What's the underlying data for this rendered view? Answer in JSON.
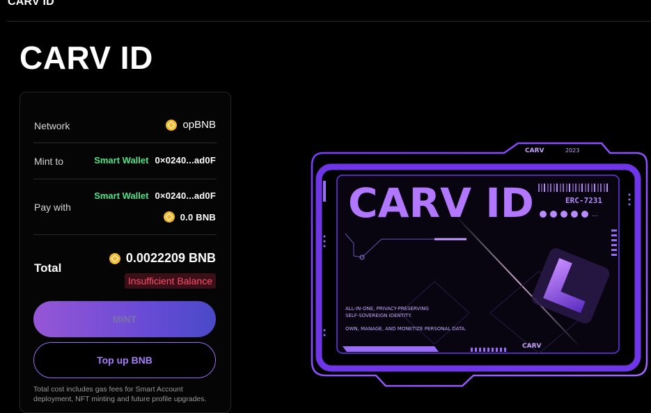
{
  "topbar": {
    "title": "CARV ID"
  },
  "page": {
    "title": "CARV ID"
  },
  "panel": {
    "network": {
      "label": "Network",
      "value": "opBNB"
    },
    "mint_to": {
      "label": "Mint to",
      "wallet": "Smart Wallet",
      "address": "0×0240...ad0F"
    },
    "pay_with": {
      "label": "Pay with",
      "wallet": "Smart Wallet",
      "address": "0×0240...ad0F",
      "balance": "0.0 BNB"
    },
    "total": {
      "label": "Total",
      "value": "0.0022209 BNB",
      "warning": "Insufficient Balance"
    },
    "mint_label": "MINT",
    "topup_label": "Top up BNB",
    "footnote": "Total cost includes gas fees for Smart Account deployment, NFT minting and future profile upgrades."
  },
  "card": {
    "brand": "CARV",
    "year": "2023",
    "title": "CARV ID",
    "standard": "ERC-7231",
    "tagline1": "ALL-IN-ONE, PRIVACY-PRESERVING",
    "tagline2": "SELF-SOVEREIGN IDENTITY.",
    "tagline3": "OWN, MANAGE, AND MONETIZE PERSONAL DATA.",
    "more": "..."
  },
  "colors": {
    "accent": "#8a4dff",
    "green": "#4fe38a",
    "warning": "#ff4d6a",
    "bnb": "#f3ba2f"
  },
  "icons": [
    "bnb-coin-icon",
    "social-icons"
  ]
}
